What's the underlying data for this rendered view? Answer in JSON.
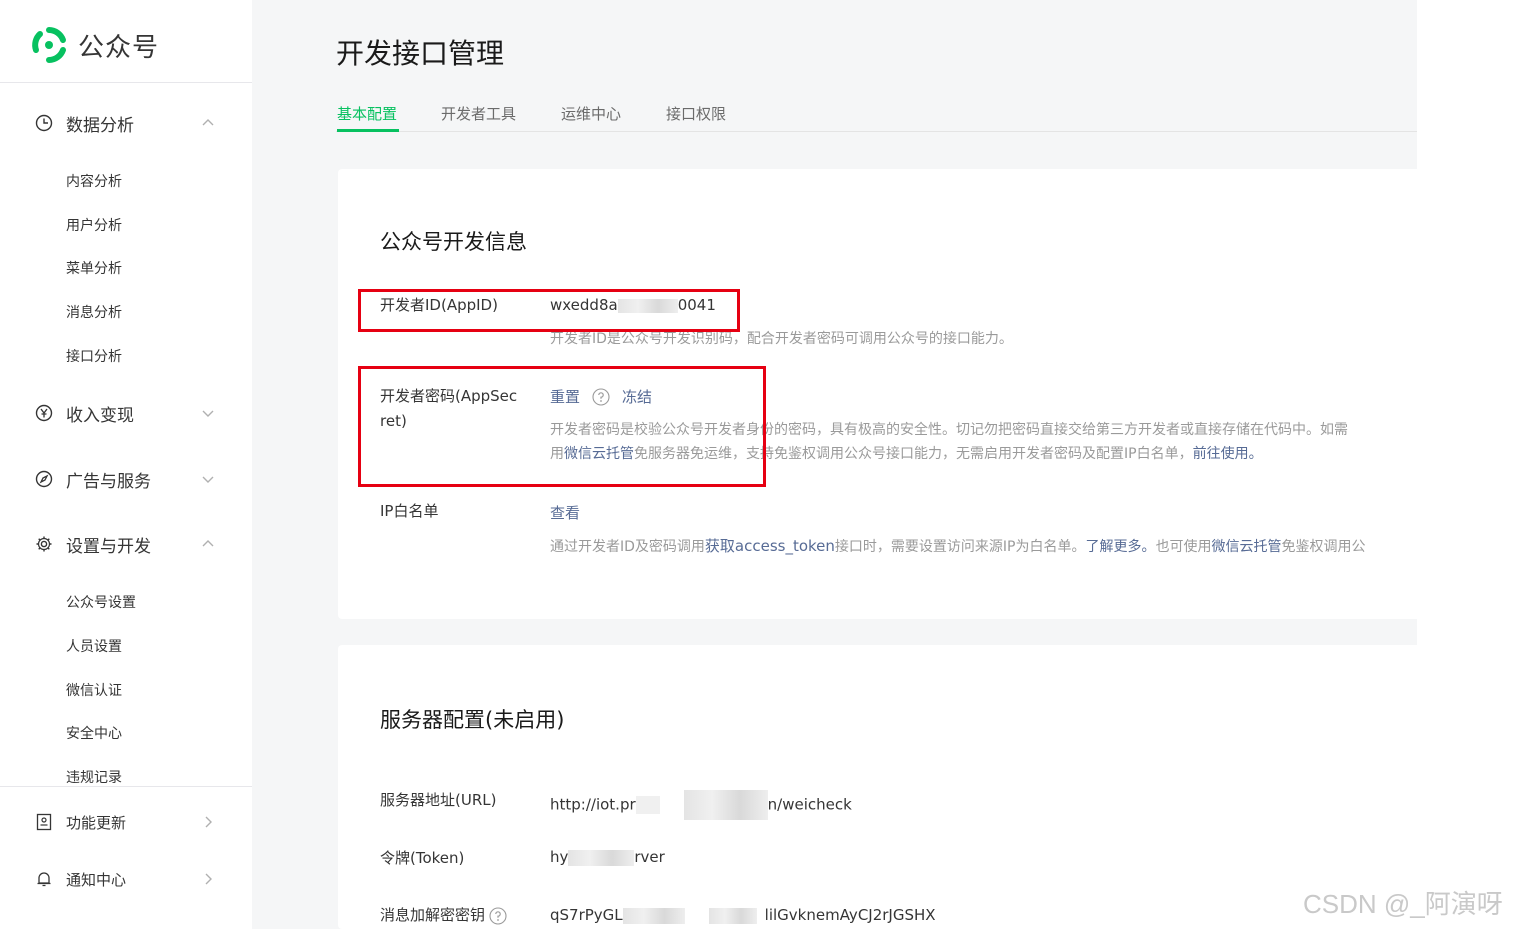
{
  "app": {
    "name": "公众号",
    "brand_color": "#07c160"
  },
  "sidebar": {
    "groups": [
      {
        "label": "数据分析",
        "icon": "clock-icon",
        "expanded": true
      },
      {
        "label": "收入变现",
        "icon": "yen-icon",
        "expanded": false
      },
      {
        "label": "广告与服务",
        "icon": "compass-icon",
        "expanded": false
      },
      {
        "label": "设置与开发",
        "icon": "gear-icon",
        "expanded": true
      },
      {
        "label": "功能更新",
        "icon": "document-icon",
        "expanded": false
      },
      {
        "label": "通知中心",
        "icon": "bell-icon",
        "expanded": false
      }
    ],
    "analytics_items": [
      "内容分析",
      "用户分析",
      "菜单分析",
      "消息分析",
      "接口分析"
    ],
    "settings_items": [
      "公众号设置",
      "人员设置",
      "微信认证",
      "安全中心",
      "违规记录"
    ]
  },
  "page": {
    "title": "开发接口管理"
  },
  "tabs": [
    "基本配置",
    "开发者工具",
    "运维中心",
    "接口权限"
  ],
  "dev_info": {
    "title": "公众号开发信息",
    "appid": {
      "label": "开发者ID(AppID)",
      "value_prefix": "wxedd8a",
      "value_suffix": "0041",
      "desc": "开发者ID是公众号开发识别码，配合开发者密码可调用公众号的接口能力。"
    },
    "secret": {
      "label_line1": "开发者密码(AppSec",
      "label_line2": "ret)",
      "reset": "重置",
      "freeze": "冻结",
      "desc1": "开发者密码是校验公众号开发者身份的密码，具有极高的安全性。切记勿把密码直接交给第三方开发者或直接存储在代码中。如需",
      "desc2_a": "用",
      "desc2_link": "微信云托管",
      "desc2_b": "免服务器免运维，支持免鉴权调用公众号接口能力，无需启用开发者密码及配置IP白名单，",
      "desc2_link2": "前往使用。"
    },
    "ip": {
      "label": "IP白名单",
      "view": "查看",
      "desc_a": "通过开发者ID及密码调用",
      "desc_link1": "获取access_token",
      "desc_b": "接口时，需要设置访问来源IP为白名单。",
      "desc_link2": "了解更多。",
      "desc_c": "也可使用",
      "desc_link3": "微信云托管",
      "desc_d": "免鉴权调用公"
    }
  },
  "server_config": {
    "title": "服务器配置(未启用)",
    "url": {
      "label": "服务器地址(URL)",
      "prefix": "http://iot.pr",
      "suffix": "n/weicheck"
    },
    "token": {
      "label": "令牌(Token)",
      "prefix": "hy",
      "suffix": "rver"
    },
    "aeskey": {
      "label": "消息加解密密钥",
      "prefix": "qS7rPyGL",
      "suffix": "lilGvknemAyCJ2rJGSHX"
    }
  },
  "watermark": "CSDN @_阿演呀"
}
